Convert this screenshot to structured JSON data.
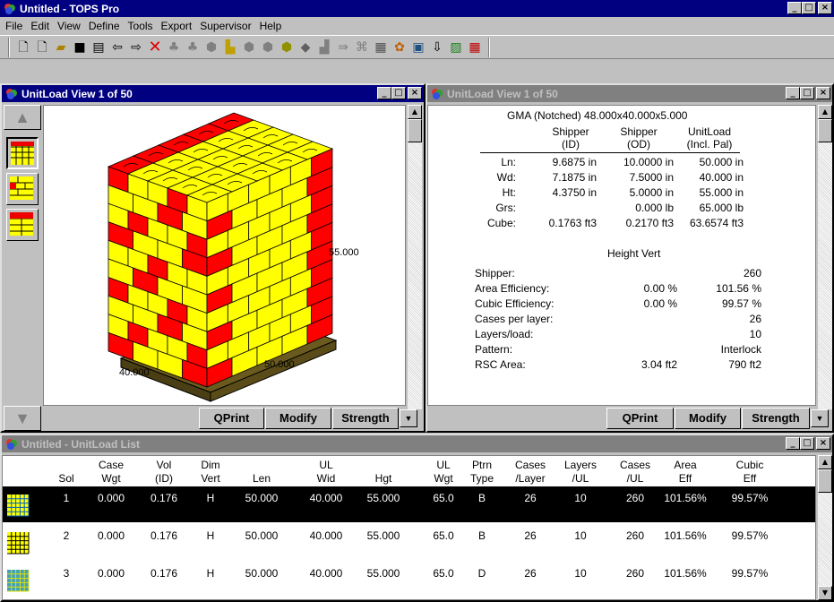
{
  "app_title": "Untitled - TOPS Pro",
  "menu": [
    "File",
    "Edit",
    "View",
    "Define",
    "Tools",
    "Export",
    "Supervisor",
    "Help"
  ],
  "toolbar_icons": [
    "new-doc-icon",
    "new-doc2-icon",
    "open-folder-icon",
    "save-icon",
    "print-icon",
    "back-arrow-icon",
    "forward-arrow-icon",
    "delete-x-icon",
    "tool-1-icon",
    "tool-2-icon",
    "tool-3-icon",
    "tool-4-icon",
    "tool-5-icon",
    "tool-6-icon",
    "tool-7-icon",
    "tool-8-icon",
    "tool-9-icon",
    "tool-10-icon",
    "tool-11-icon",
    "tool-12-icon",
    "tool-13-icon",
    "tool-14-icon",
    "tool-15-icon",
    "tool-16-icon",
    "tool-17-icon"
  ],
  "left_view": {
    "title": "UnitLoad View  1 of 50",
    "dim_height": "55.000",
    "dim_depth": "50.000",
    "dim_width": "40.000",
    "buttons": [
      "QPrint",
      "Modify",
      "Strength"
    ]
  },
  "right_view": {
    "title": "UnitLoad View  1 of 50",
    "header": "GMA (Notched) 48.000x40.000x5.000",
    "col_headers": [
      [
        "Shipper",
        "(ID)"
      ],
      [
        "Shipper",
        "(OD)"
      ],
      [
        "UnitLoad",
        "(Incl. Pal)"
      ]
    ],
    "rows": [
      {
        "label": "Ln:",
        "c1": "9.6875 in",
        "c2": "10.0000 in",
        "c3": "50.000 in"
      },
      {
        "label": "Wd:",
        "c1": "7.1875 in",
        "c2": "7.5000 in",
        "c3": "40.000 in"
      },
      {
        "label": "Ht:",
        "c1": "4.3750 in",
        "c2": "5.0000 in",
        "c3": "55.000 in"
      },
      {
        "label": "Grs:",
        "c1": "",
        "c2": "0.000 lb",
        "c3": "65.000 lb"
      },
      {
        "label": "Cube:",
        "c1": "0.1763 ft3",
        "c2": "0.2170 ft3",
        "c3": "63.6574 ft3"
      }
    ],
    "height_vert": "Height Vert",
    "stats": [
      {
        "label": "Shipper:",
        "v1": "",
        "v2": "260"
      },
      {
        "label": "Area Efficiency:",
        "v1": "0.00 %",
        "v2": "101.56 %"
      },
      {
        "label": "Cubic Efficiency:",
        "v1": "0.00 %",
        "v2": "99.57 %"
      },
      {
        "label": "Cases per layer:",
        "v1": "",
        "v2": "26"
      },
      {
        "label": "Layers/load:",
        "v1": "",
        "v2": "10"
      },
      {
        "label": "Pattern:",
        "v1": "",
        "v2": "Interlock"
      },
      {
        "label": "RSC Area:",
        "v1": "3.04 ft2",
        "v2": "790 ft2"
      }
    ],
    "buttons": [
      "QPrint",
      "Modify",
      "Strength"
    ]
  },
  "list": {
    "title": "Untitled - UnitLoad List",
    "headers": [
      [
        "",
        "Sol"
      ],
      [
        "Case",
        "Wgt"
      ],
      [
        "Vol",
        "(ID)"
      ],
      [
        "Dim",
        "Vert"
      ],
      [
        "",
        "Len"
      ],
      [
        "UL",
        "Wid"
      ],
      [
        "",
        "Hgt"
      ],
      [
        "UL",
        "Wgt"
      ],
      [
        "Ptrn",
        "Type"
      ],
      [
        "Cases",
        "/Layer"
      ],
      [
        "Layers",
        "/UL"
      ],
      [
        "Cases",
        "/UL"
      ],
      [
        "Area",
        "Eff"
      ],
      [
        "Cubic",
        "Eff"
      ]
    ],
    "rows": [
      [
        "1",
        "0.000",
        "0.176",
        "H",
        "50.000",
        "40.000",
        "55.000",
        "65.0",
        "B",
        "26",
        "10",
        "260",
        "101.56%",
        "99.57%"
      ],
      [
        "2",
        "0.000",
        "0.176",
        "H",
        "50.000",
        "40.000",
        "55.000",
        "65.0",
        "B",
        "26",
        "10",
        "260",
        "101.56%",
        "99.57%"
      ],
      [
        "3",
        "0.000",
        "0.176",
        "H",
        "50.000",
        "40.000",
        "55.000",
        "65.0",
        "D",
        "26",
        "10",
        "260",
        "101.56%",
        "99.57%"
      ]
    ],
    "selected_row": 0
  },
  "colors": {
    "title_active": "#000080",
    "title_inactive": "#808080",
    "box_yellow": "#ffff00",
    "box_red": "#ff0000",
    "pallet": "#6b5a1e"
  }
}
